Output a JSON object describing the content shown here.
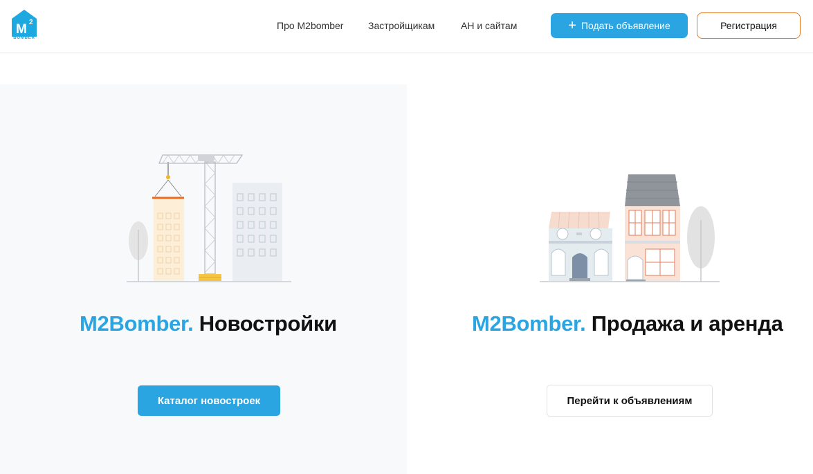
{
  "header": {
    "logo": {
      "mark": "M",
      "sup": "2",
      "word": "BOMBER",
      "color": "#1da8e0"
    },
    "nav": [
      {
        "label": "Про M2bomber"
      },
      {
        "label": "Застройщикам"
      },
      {
        "label": "АН и сайтам"
      }
    ],
    "post_button": {
      "icon": "plus-icon",
      "label": "Подать объявление",
      "color": "#2aa5e2"
    },
    "register_button": {
      "label": "Регистрация",
      "border_color": "#e07a26"
    }
  },
  "left_panel": {
    "illustration": "construction-crane-illustration",
    "brand": "M2Bomber.",
    "title": "Новостройки",
    "button_label": "Каталог новостроек"
  },
  "right_panel": {
    "illustration": "townhouses-illustration",
    "brand": "M2Bomber.",
    "title": "Продажа и аренда",
    "button_label": "Перейти к объявлениям"
  }
}
